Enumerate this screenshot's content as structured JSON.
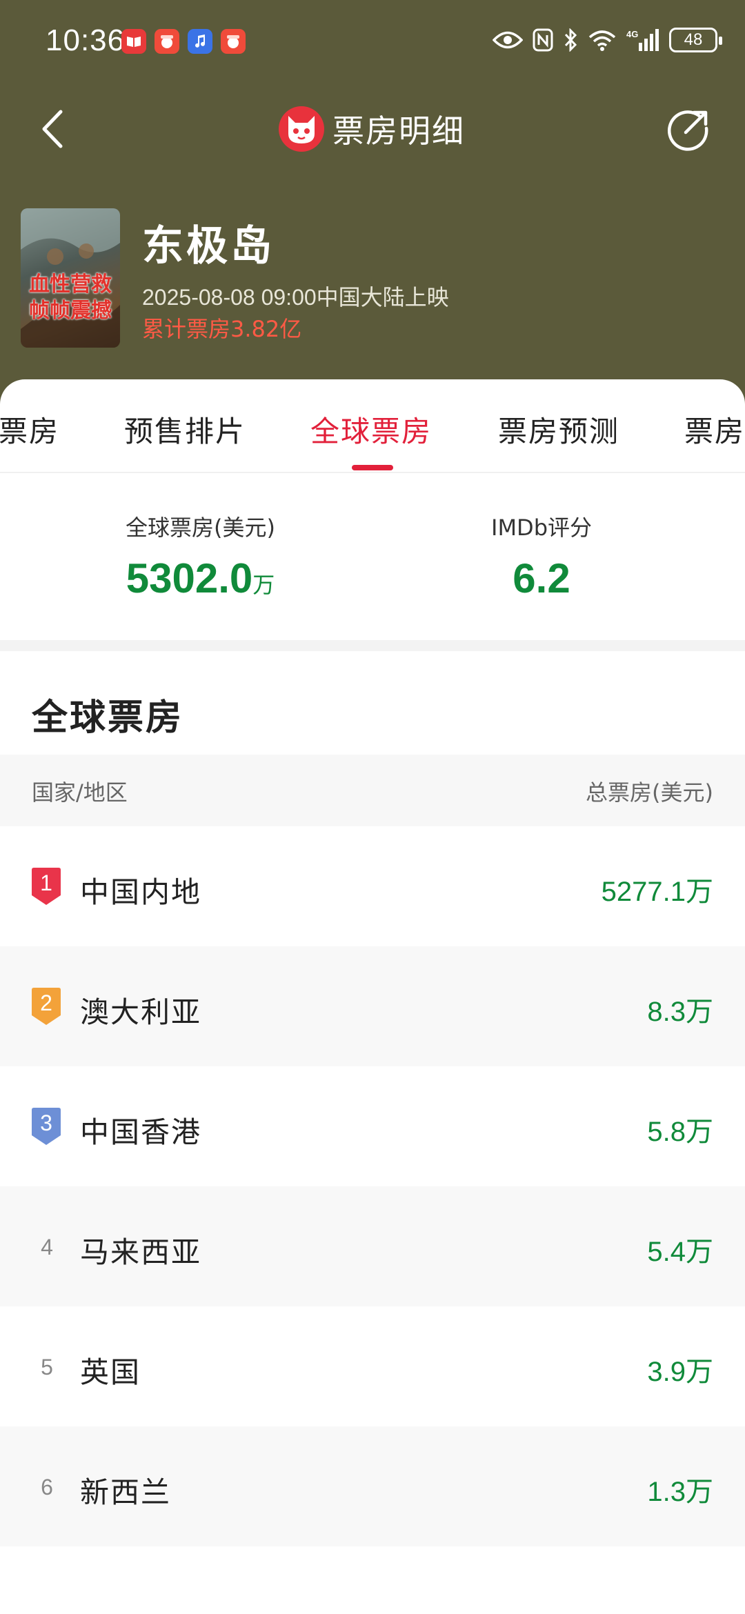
{
  "status_bar": {
    "time": "10:36",
    "apps": [
      "app-book-icon",
      "app-red-icon",
      "app-music-icon",
      "app-red2-icon"
    ],
    "network": "4G",
    "battery": "48"
  },
  "nav": {
    "title": "票房明细"
  },
  "movie": {
    "title": "东极岛",
    "poster_text": "血性营救 帧帧震撼",
    "release": "2025-08-08 09:00中国大陆上映",
    "total": "累计票房3.82亿"
  },
  "tabs": [
    {
      "label": "票房"
    },
    {
      "label": "预售排片"
    },
    {
      "label": "全球票房"
    },
    {
      "label": "票房预测"
    },
    {
      "label": "票房"
    }
  ],
  "active_tab": "全球票房",
  "summary": {
    "global_label": "全球票房(美元)",
    "global_value": "5302.0",
    "global_unit": "万",
    "imdb_label": "IMDb评分",
    "imdb_value": "6.2"
  },
  "section": {
    "title": "全球票房",
    "col_country": "国家/地区",
    "col_total": "总票房(美元)"
  },
  "rows": [
    {
      "rank": "1",
      "country": "中国内地",
      "amount": "5277.1万"
    },
    {
      "rank": "2",
      "country": "澳大利亚",
      "amount": "8.3万"
    },
    {
      "rank": "3",
      "country": "中国香港",
      "amount": "5.8万"
    },
    {
      "rank": "4",
      "country": "马来西亚",
      "amount": "5.4万"
    },
    {
      "rank": "5",
      "country": "英国",
      "amount": "3.9万"
    },
    {
      "rank": "6",
      "country": "新西兰",
      "amount": "1.3万"
    }
  ],
  "colors": {
    "header_bg": "#5b5a3a",
    "accent_red": "#e2203a",
    "value_green": "#108a3a",
    "rank1": "#e9344a",
    "rank2": "#f3a23a",
    "rank3": "#6d8fd6"
  }
}
